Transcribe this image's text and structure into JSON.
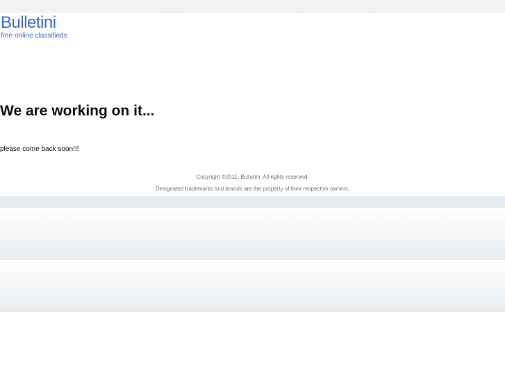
{
  "logo": {
    "title": "Bulletini",
    "tagline": "free online classifieds"
  },
  "main": {
    "heading": "We are working on it...",
    "message": "please come back soon!!!"
  },
  "footer": {
    "copyright": "Copyright ©2011, Bulletini. All rights reserved.",
    "trademarks": "Designated trademarks and brands are the property of their respective owners."
  },
  "colors": {
    "brand": "#3d6fd1",
    "text": "#111111",
    "footer_text": "#777777"
  }
}
